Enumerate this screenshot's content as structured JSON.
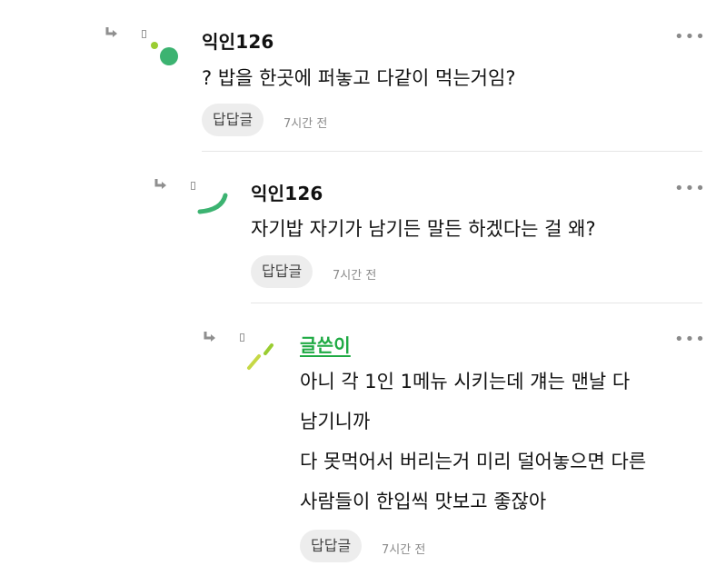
{
  "comments": [
    {
      "author": "익인126",
      "lines": [
        "? 밥을 한곳에 퍼놓고 다같이 먹는거임?"
      ],
      "reply_label": "답답글",
      "time": "7시간 전",
      "more_icon": "more-horizontal-icon"
    },
    {
      "author": "익인126",
      "lines": [
        "자기밥 자기가 남기든 말든 하겠다는 걸 왜?"
      ],
      "reply_label": "답답글",
      "time": "7시간 전",
      "more_icon": "more-horizontal-icon"
    },
    {
      "author": "글쓴이",
      "lines": [
        "아니 각 1인 1메뉴 시키는데 걔는 맨날 다",
        "남기니까",
        "다 못먹어서 버리는거 미리 덜어놓으면 다른",
        "사람들이 한입씩 맛보고 좋잖아"
      ],
      "reply_label": "답답글",
      "time": "7시간 전",
      "more_icon": "more-horizontal-icon"
    }
  ],
  "colors": {
    "writer_green": "#1faa44",
    "avatar_green": "#3cb371",
    "avatar_lime": "#9acd32"
  }
}
